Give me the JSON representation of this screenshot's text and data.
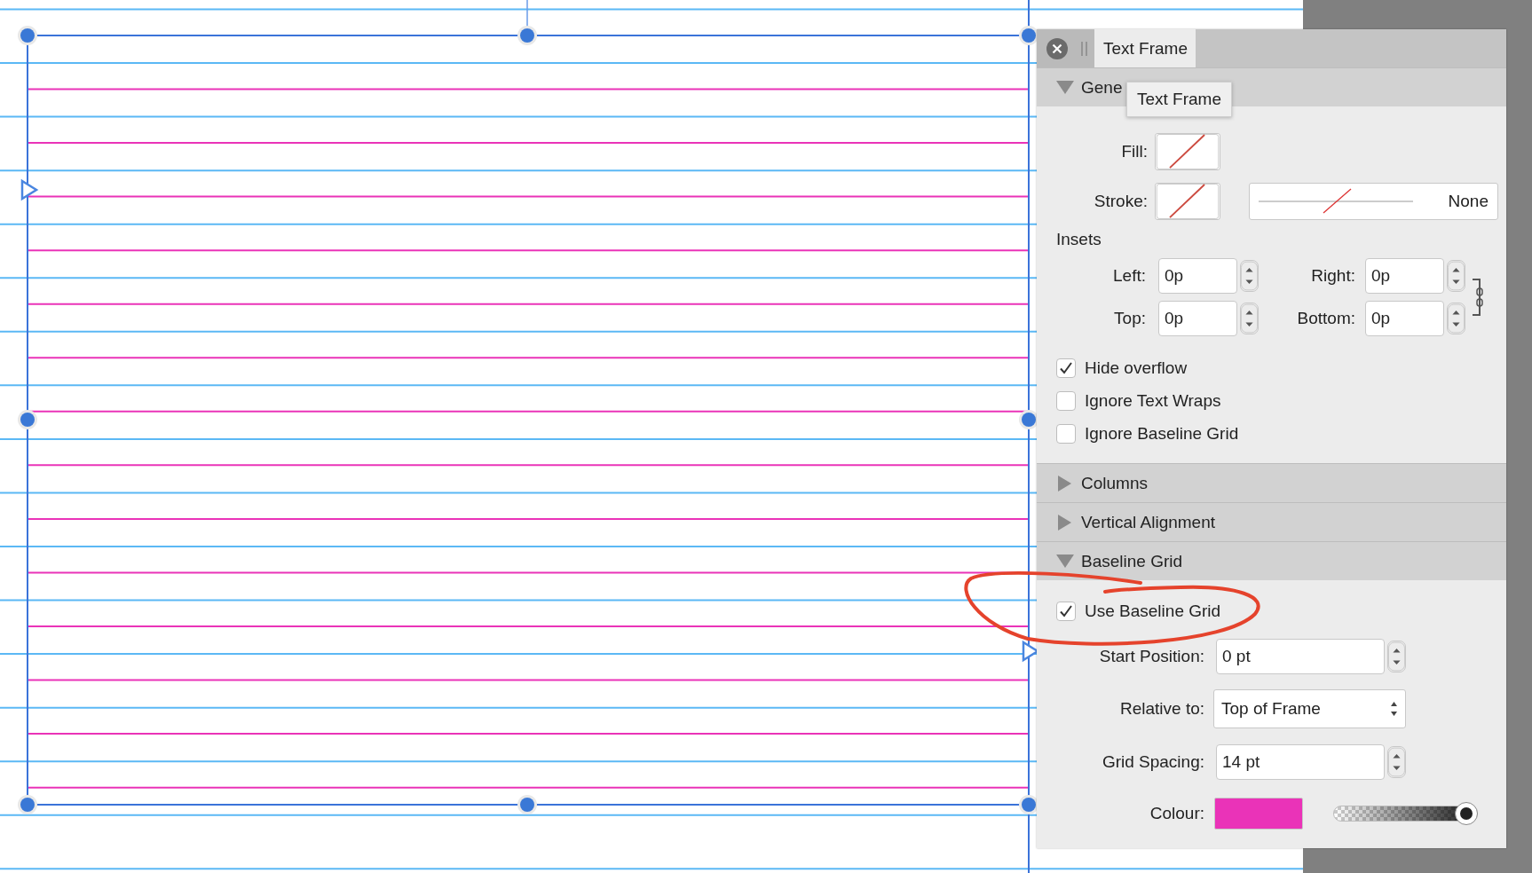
{
  "panel_tabs": [
    {
      "label": "Text Frame",
      "selected": true
    }
  ],
  "tooltip": "Text Frame",
  "sections": [
    {
      "title": "Gene",
      "expanded": true,
      "rows": [
        {
          "kind": "swatch",
          "label": "Fill:"
        },
        {
          "kind": "stroke",
          "label": "Stroke:",
          "style": "None"
        },
        {
          "kind": "heading",
          "text": "Insets"
        },
        {
          "kind": "insets",
          "items": [
            {
              "label": "Left:",
              "value": "0p"
            },
            {
              "label": "Right:",
              "value": "0p"
            },
            {
              "label": "Top:",
              "value": "0p"
            },
            {
              "label": "Bottom:",
              "value": "0p"
            }
          ]
        },
        {
          "kind": "checkbox",
          "label": "Hide overflow",
          "checked": true
        },
        {
          "kind": "checkbox",
          "label": "Ignore Text Wraps",
          "checked": false
        },
        {
          "kind": "checkbox",
          "label": "Ignore Baseline Grid",
          "checked": false
        }
      ]
    },
    {
      "title": "Columns",
      "expanded": false
    },
    {
      "title": "Vertical Alignment",
      "expanded": false
    },
    {
      "title": "Baseline Grid",
      "expanded": true,
      "rows": [
        {
          "kind": "checkbox",
          "label": "Use Baseline Grid",
          "checked": true
        },
        {
          "kind": "spin",
          "label": "Start Position:",
          "value": "0 pt"
        },
        {
          "kind": "select",
          "label": "Relative to:",
          "value": "Top of Frame"
        },
        {
          "kind": "spin",
          "label": "Grid Spacing:",
          "value": "14 pt"
        },
        {
          "kind": "colour",
          "label": "Colour:",
          "color": "#ea33b8",
          "level": 1
        }
      ]
    }
  ]
}
